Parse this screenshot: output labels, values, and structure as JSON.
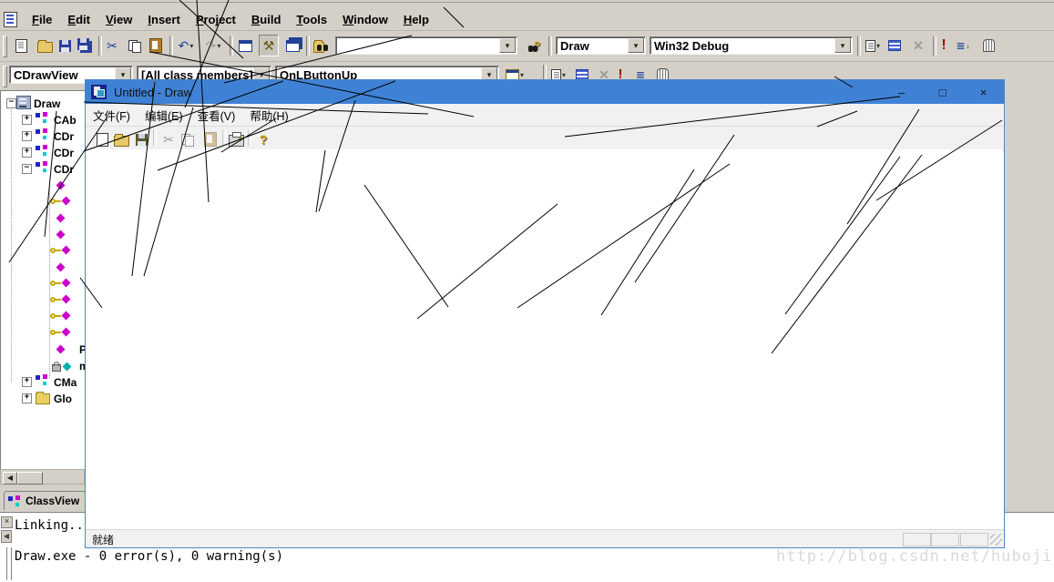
{
  "ide": {
    "menubar": {
      "items": [
        "File",
        "Edit",
        "View",
        "Insert",
        "Project",
        "Build",
        "Tools",
        "Window",
        "Help"
      ]
    },
    "toolbar_main": {
      "icons": [
        "new-document",
        "open-folder",
        "save",
        "save-all",
        "cut-scissors",
        "copy",
        "paste",
        "undo-arrow",
        "redo-arrow",
        "workspace-pane",
        "wizard-hammer",
        "cascade-windows",
        "find-in-files",
        "search-help",
        "compile-file",
        "build",
        "stop-build",
        "execute-program",
        "go",
        "insert-breakpoint-hand"
      ],
      "find_combo_value": "",
      "project_combo_value": "Draw",
      "config_combo_value": "Win32 Debug"
    },
    "wizardbar": {
      "class_combo_value": "CDrawView",
      "members_combo_value": "[All class members]",
      "function_combo_value": "OnLButtonUp",
      "icons": [
        "wizard-action",
        "compile-file",
        "build",
        "stop-build",
        "execute-program",
        "go",
        "insert-breakpoint-hand"
      ]
    },
    "workspace": {
      "tab_label": "ClassView",
      "rows": [
        {
          "kind": "root",
          "label": "Draw",
          "expand": "-"
        },
        {
          "kind": "class",
          "label": "CAb",
          "expand": "+"
        },
        {
          "kind": "class",
          "label": "CDr",
          "expand": "+"
        },
        {
          "kind": "class",
          "label": "CDr",
          "expand": "+"
        },
        {
          "kind": "class",
          "label": "CDr",
          "expand": "-"
        },
        {
          "kind": "member",
          "icon": "diamond",
          "label": ""
        },
        {
          "kind": "member",
          "icon": "key-diamond",
          "label": ""
        },
        {
          "kind": "member",
          "icon": "diamond",
          "label": ""
        },
        {
          "kind": "member",
          "icon": "diamond",
          "label": ""
        },
        {
          "kind": "member",
          "icon": "key-diamond",
          "label": ""
        },
        {
          "kind": "member",
          "icon": "diamond",
          "label": ""
        },
        {
          "kind": "member",
          "icon": "key-diamond",
          "label": ""
        },
        {
          "kind": "member",
          "icon": "key-diamond",
          "label": ""
        },
        {
          "kind": "member",
          "icon": "key-diamond",
          "label": ""
        },
        {
          "kind": "member",
          "icon": "key-diamond",
          "label": ""
        },
        {
          "kind": "member",
          "icon": "diamond",
          "label": "P"
        },
        {
          "kind": "member",
          "icon": "lock-diamond",
          "label": "m"
        },
        {
          "kind": "class",
          "label": "CMa",
          "expand": "+"
        },
        {
          "kind": "folder",
          "label": "Glo",
          "expand": "+"
        }
      ]
    },
    "output": {
      "line1": "Linking...",
      "line2": "Draw.exe - 0 error(s), 0 warning(s)"
    }
  },
  "app": {
    "title": "Untitled - Draw",
    "menu": [
      "文件(F)",
      "编辑(E)",
      "查看(V)",
      "帮助(H)"
    ],
    "toolbar_icons": [
      "new-document",
      "open-folder",
      "save",
      "cut-scissors",
      "copy",
      "paste",
      "print",
      "about-help"
    ],
    "status": "就绪",
    "controls": {
      "minimize": "–",
      "maximize": "□",
      "close": "×"
    }
  },
  "watermark": "http://blog.csdn.net/hubojing",
  "colors": {
    "titlebar_blue": "#3f82d5",
    "ide_chrome": "#d4d0c8",
    "member_magenta": "#cc00cc",
    "member_teal": "#00b0b0",
    "scribble": "#000000"
  },
  "scribble": {
    "segments": [
      [
        216,
        0,
        229,
        222
      ],
      [
        251,
        0,
        203,
        118
      ],
      [
        197,
        0,
        267,
        64
      ],
      [
        165,
        57,
        520,
        128
      ],
      [
        92,
        112,
        470,
        125
      ],
      [
        92,
        166,
        311,
        89
      ],
      [
        173,
        187,
        434,
        89
      ],
      [
        246,
        91,
        452,
        39
      ],
      [
        487,
        8,
        509,
        30
      ],
      [
        118,
        128,
        10,
        288
      ],
      [
        62,
        122,
        49,
        260
      ],
      [
        170,
        90,
        145,
        303
      ],
      [
        212,
        118,
        158,
        303
      ],
      [
        390,
        110,
        350,
        232
      ],
      [
        357,
        165,
        347,
        233
      ],
      [
        243,
        167,
        303,
        130
      ],
      [
        400,
        203,
        492,
        337
      ],
      [
        568,
        338,
        801,
        180
      ],
      [
        660,
        346,
        762,
        186
      ],
      [
        697,
        310,
        806,
        148
      ],
      [
        458,
        350,
        612,
        224
      ],
      [
        847,
        388,
        1012,
        170
      ],
      [
        862,
        345,
        988,
        172
      ],
      [
        930,
        246,
        1009,
        120
      ],
      [
        962,
        220,
        1100,
        132
      ],
      [
        620,
        150,
        988,
        106
      ],
      [
        897,
        139,
        941,
        122
      ],
      [
        916,
        84,
        936,
        96
      ],
      [
        88,
        305,
        112,
        338
      ]
    ]
  }
}
